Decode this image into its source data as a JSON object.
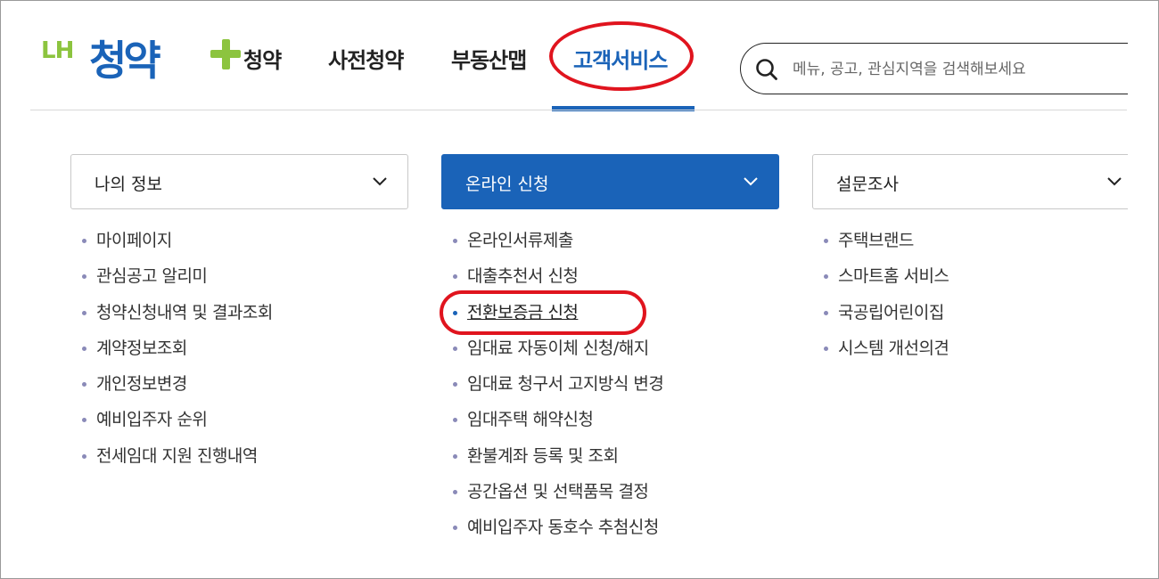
{
  "logo": {
    "lh": "LH",
    "name": "청약"
  },
  "nav": {
    "items": [
      "청약",
      "사전청약",
      "부동산맵",
      "고객서비스"
    ],
    "active_index": 3
  },
  "search": {
    "placeholder": "메뉴, 공고, 관심지역을 검색해보세요"
  },
  "menus": [
    {
      "title": "나의 정보",
      "items": [
        "마이페이지",
        "관심공고 알리미",
        "청약신청내역 및 결과조회",
        "계약정보조회",
        "개인정보변경",
        "예비입주자 순위",
        "전세임대 지원 진행내역"
      ]
    },
    {
      "title": "온라인 신청",
      "active": true,
      "items": [
        "온라인서류제출",
        "대출추천서 신청",
        "전환보증금 신청",
        "임대료 자동이체 신청/해지",
        "임대료 청구서 고지방식 변경",
        "임대주택 해약신청",
        "환불계좌 등록 및 조회",
        "공간옵션 및 선택품목 결정",
        "예비입주자 동호수 추첨신청"
      ],
      "current_item": 2
    },
    {
      "title": "설문조사",
      "items": [
        "주택브랜드",
        "스마트홈 서비스",
        "국공립어린이집",
        "시스템 개선의견"
      ]
    }
  ],
  "colors": {
    "brand_blue": "#1a63b8",
    "brand_green": "#8cc43f",
    "highlight_red": "#e0141e"
  }
}
